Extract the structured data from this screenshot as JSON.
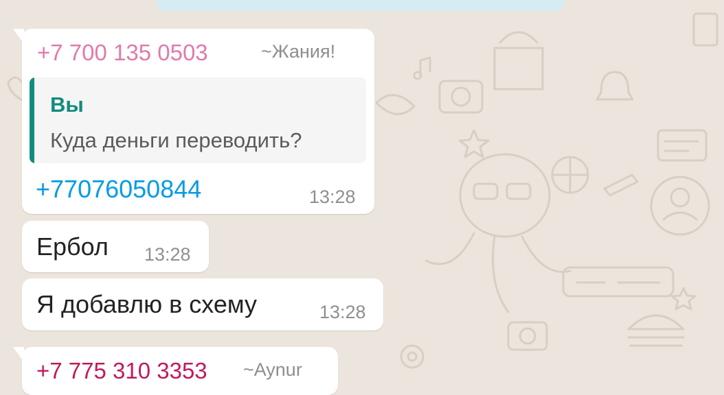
{
  "colors": {
    "chat_bg": "#ece5dd",
    "bubble_bg": "#ffffff",
    "sender1": "#e07aa9",
    "sender2": "#c2185b",
    "quote_accent": "#128c7e",
    "link": "#039be5",
    "top_strip": "#d6ecf4"
  },
  "messages": [
    {
      "sender_phone": "+7 700 135 0503",
      "sender_name": "~Жания!",
      "quote": {
        "author": "Вы",
        "text": "Куда деньги переводить?"
      },
      "text": "+77076050844",
      "time": "13:28"
    },
    {
      "text": "Ербол",
      "time": "13:28"
    },
    {
      "text": "Я добавлю в схему",
      "time": "13:28"
    },
    {
      "sender_phone": "+7 775 310 3353",
      "sender_name": "~Aynur"
    }
  ]
}
